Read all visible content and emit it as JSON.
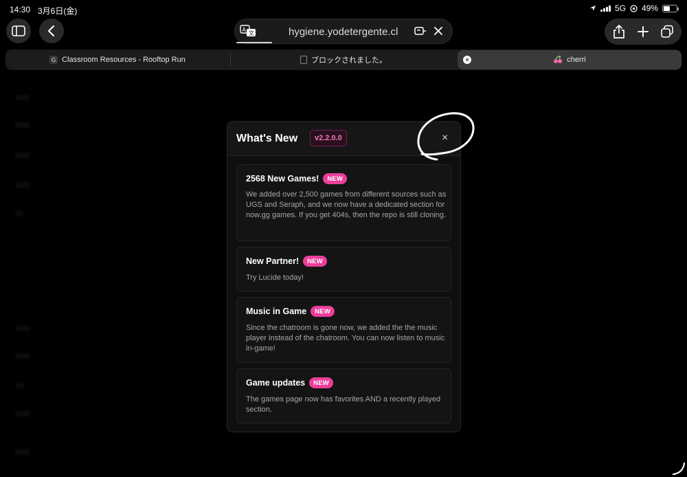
{
  "status_bar": {
    "time": "14:30",
    "date": "3月6日(金)",
    "network": "5G",
    "battery": "49%",
    "battery_level": 0.49
  },
  "address_bar": {
    "url": "hygiene.yodetergente.cl"
  },
  "tabs": [
    {
      "label": "Classroom Resources - Rooftop Run",
      "favicon": "G",
      "active": false
    },
    {
      "label": "ブロックされました。",
      "active": false
    },
    {
      "label": "cherri",
      "active": true
    }
  ],
  "modal": {
    "title": "What's New",
    "version": "v2.2.0.0",
    "close": "×",
    "items": [
      {
        "title": "2568 New Games!",
        "badge": "NEW",
        "body": "We added over 2,500 games from different sources such as UGS and Seraph, and we now have a dedicated section for now.gg games. If you get 404s, then the repo is still cloning."
      },
      {
        "title": "New Partner!",
        "badge": "NEW",
        "body": "Try Lucide today!"
      },
      {
        "title": "Music in Game",
        "badge": "NEW",
        "body": "Since the chatroom is gone now, we added the the music player instead of the chatroom. You can now listen to music in-game!"
      },
      {
        "title": "Game updates",
        "badge": "NEW",
        "body": "The games page now has favorites AND a recently played section."
      }
    ]
  },
  "colors": {
    "accent": "#ec3e9a",
    "background": "#000000",
    "modal": "#0f0f10",
    "card": "#141415"
  }
}
